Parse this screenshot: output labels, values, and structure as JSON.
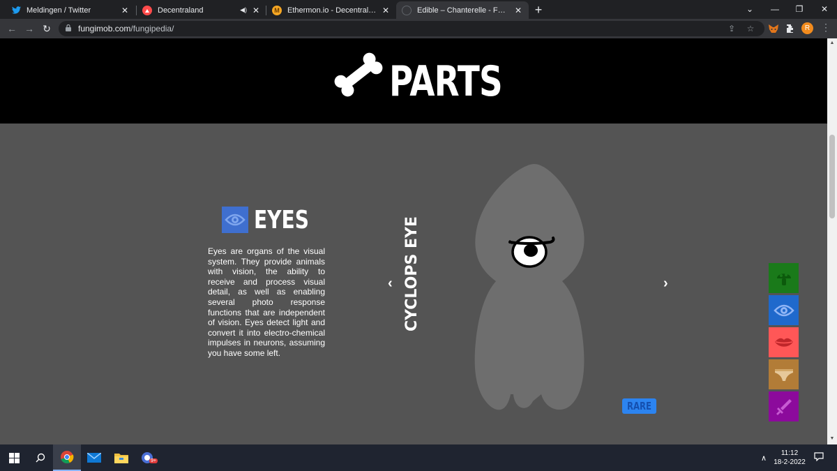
{
  "browser": {
    "tabs": [
      {
        "title": "Meldingen / Twitter",
        "favicon": "twitter-icon",
        "color": "#1d9bf0"
      },
      {
        "title": "Decentraland",
        "favicon": "decentraland-icon",
        "color": "#ff4b4b"
      },
      {
        "title": "Ethermon.io - Decentralized Wor",
        "favicon": "ethermon-icon",
        "color": "#f5a623"
      },
      {
        "title": "Edible – Chanterelle - Fungimob",
        "favicon": "fungimob-icon",
        "color": "#5f6368"
      }
    ],
    "active_tab_index": 3,
    "url_host": "fungimob.com",
    "url_path": "/fungipedia/",
    "profile_initial": "R"
  },
  "page": {
    "section_heading": "PARTS",
    "part": {
      "title": "EYES",
      "description": "Eyes are organs of the visual system. They provide animals with vision, the ability to receive and process visual detail, as well as enabling several photo response functions that are independent of vision. Eyes detect light and convert it into electro-chemical impulses in neurons, assuming you have some left.",
      "item_name": "CYCLOPS EYE",
      "rarity": "RARE"
    },
    "categories": [
      {
        "name": "mushroom-head",
        "color": "#1a7a1a"
      },
      {
        "name": "eyes",
        "color": "#1f69cc"
      },
      {
        "name": "mouth",
        "color": "#ff5757"
      },
      {
        "name": "underwear",
        "color": "#b27c37"
      },
      {
        "name": "weapon",
        "color": "#8c0a9c"
      }
    ],
    "colors": {
      "hero_bg": "#000000",
      "page_bg": "#545454",
      "character": "#6e6e6e"
    }
  },
  "taskbar": {
    "time": "11:12",
    "date": "18-2-2022",
    "notification_badge": "9+"
  }
}
